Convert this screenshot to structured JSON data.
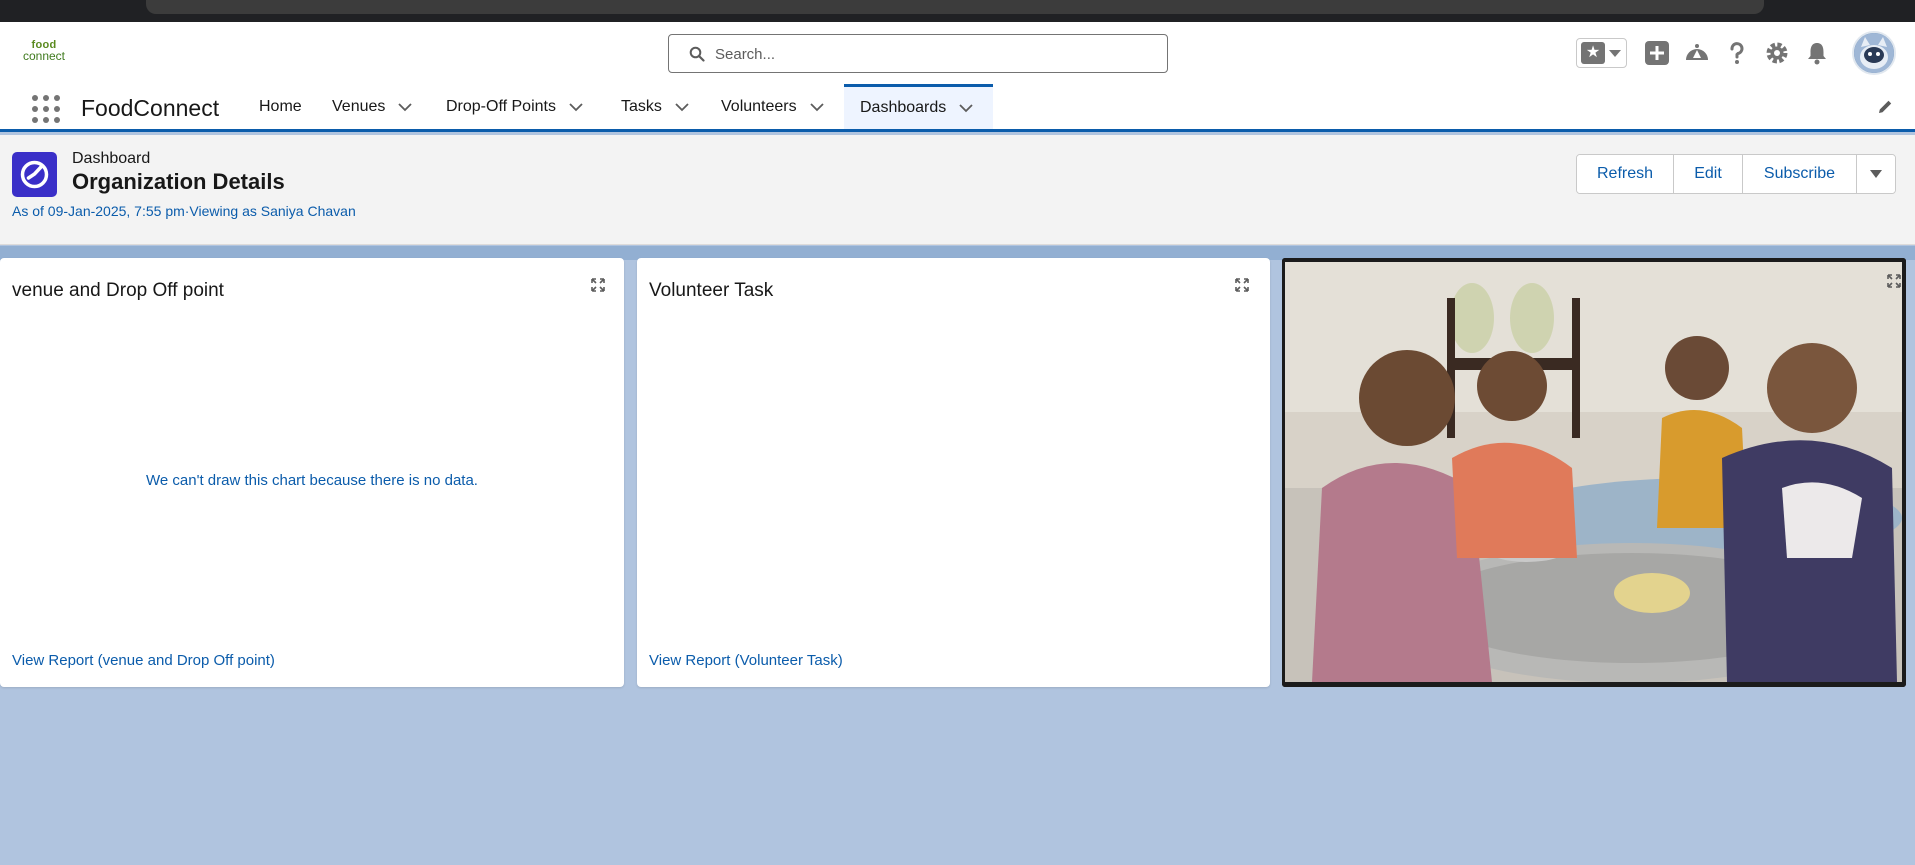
{
  "global_header": {
    "logo": {
      "line1": "food",
      "line2": "connect"
    },
    "search": {
      "placeholder": "Search..."
    },
    "icons": [
      "star-icon",
      "add-icon",
      "trailhead-icon",
      "help-icon",
      "setup-gear-icon",
      "notification-bell-icon"
    ]
  },
  "nav": {
    "app_name": "FoodConnect",
    "items": [
      {
        "label": "Home",
        "has_menu": false
      },
      {
        "label": "Venues",
        "has_menu": true
      },
      {
        "label": "Drop-Off Points",
        "has_menu": true
      },
      {
        "label": "Tasks",
        "has_menu": true
      },
      {
        "label": "Volunteers",
        "has_menu": true
      },
      {
        "label": "Dashboards",
        "has_menu": true,
        "active": true
      }
    ]
  },
  "dashboard": {
    "type_label": "Dashboard",
    "title": "Organization Details",
    "meta": "As of 09-Jan-2025, 7:55 pm·Viewing as Saniya Chavan",
    "buttons": {
      "refresh": "Refresh",
      "edit": "Edit",
      "subscribe": "Subscribe"
    }
  },
  "components": [
    {
      "title": "venue and Drop Off point",
      "message": "We can't draw this chart because there is no data.",
      "report_link": "View Report (venue and Drop Off point)"
    },
    {
      "title": "Volunteer Task",
      "message": "",
      "report_link": "View Report (Volunteer Task)"
    }
  ],
  "colors": {
    "brand_blue": "#0b5cab",
    "canvas_bg": "#b0c4df",
    "dashboard_icon": "#3a2fc8"
  }
}
